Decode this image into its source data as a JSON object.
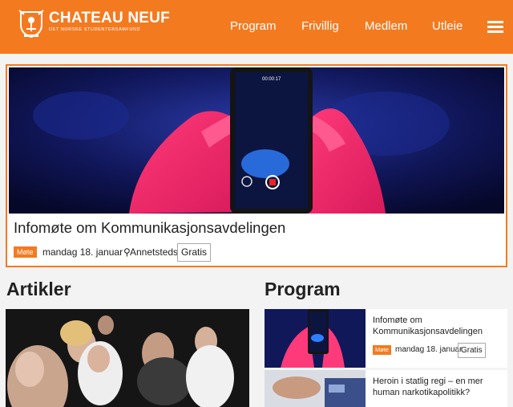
{
  "header": {
    "logo_title": "CHATEAU NEUF",
    "logo_subtitle": "DET NORSKE STUDENTERSAMFUND",
    "nav": [
      "Program",
      "Frivillig",
      "Medlem",
      "Utleie"
    ],
    "brand_color": "#f47a20"
  },
  "featured": {
    "title": "Infomøte om Kommunikasjonsavdelingen",
    "tag": "Møte",
    "date": "mandag 18. januar",
    "location": "Annetsteds",
    "price": "Gratis",
    "phone_time": "00:00:17"
  },
  "sections": {
    "articles": "Artikler",
    "program": "Program"
  },
  "program": [
    {
      "title": "Infomøte om Kommunikasjonsavdelingen",
      "tag": "Møte",
      "date": "mandag 18. januar",
      "price": "Gratis"
    },
    {
      "title": "Heroin i statlig regi – en mer human narkotikapolitikk?"
    }
  ]
}
